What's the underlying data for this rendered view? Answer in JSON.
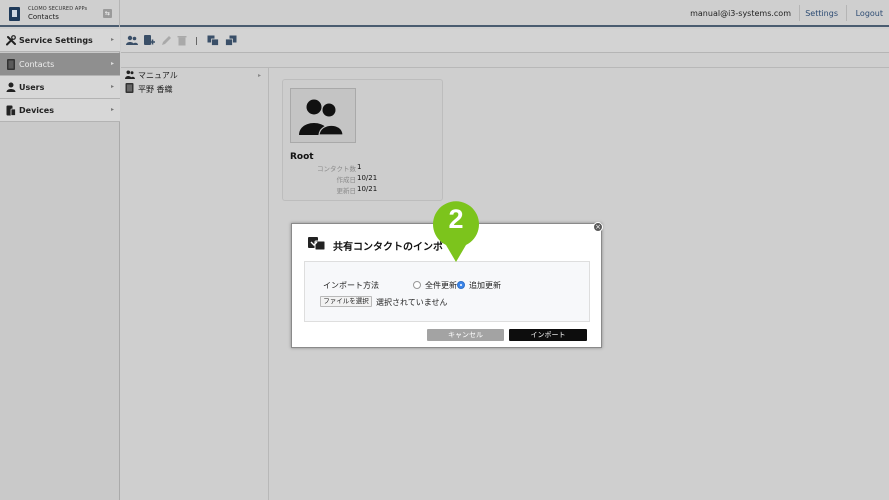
{
  "header": {
    "app_name": "CLOMO SECURED APPs",
    "app_sub": "Contacts",
    "user_email": "manual@i3-systems.com",
    "settings_link": "Settings",
    "logout_link": "Logout"
  },
  "sidebar": {
    "items": [
      {
        "label": "Service Settings",
        "icon": "tools-icon",
        "active": false
      },
      {
        "label": "Contacts",
        "icon": "contacts-icon",
        "active": true
      },
      {
        "label": "Users",
        "icon": "user-icon",
        "active": false
      },
      {
        "label": "Devices",
        "icon": "devices-icon",
        "active": false
      }
    ]
  },
  "toolbar": {
    "buttons": [
      "add-group-icon",
      "add-contact-icon",
      "edit-icon",
      "delete-icon",
      "import-icon",
      "export-icon"
    ]
  },
  "tree": {
    "items": [
      {
        "label": "マニュアル",
        "icon": "group-icon"
      },
      {
        "label": "平野 香織",
        "icon": "contact-icon"
      }
    ]
  },
  "card": {
    "title": "Root",
    "rows": [
      {
        "key": "コンタクト数",
        "value": "1"
      },
      {
        "key": "作成日",
        "value": "10/21"
      },
      {
        "key": "更新日",
        "value": "10/21"
      }
    ]
  },
  "modal": {
    "title": "共有コンタクトのインポ",
    "import_method_label": "インポート方法",
    "options": [
      {
        "label": "全件更新",
        "selected": false
      },
      {
        "label": "追加更新",
        "selected": true
      }
    ],
    "file_button": "ファイルを選択",
    "file_status": "選択されていません",
    "cancel": "キャンセル",
    "import": "インポート"
  },
  "callout": {
    "number": "2",
    "color": "#7cc41c"
  }
}
